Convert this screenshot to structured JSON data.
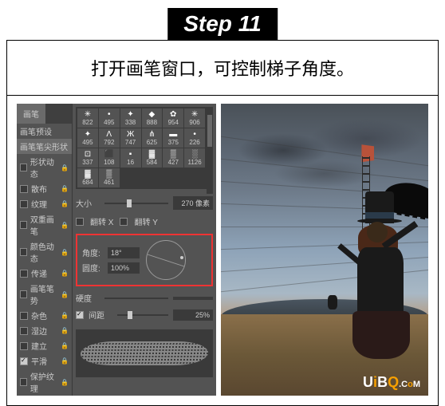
{
  "step": {
    "label": "Step 11"
  },
  "caption": "打开画笔窗口，可控制梯子角度。",
  "panel": {
    "tabs": {
      "brush": "画笔",
      "preset": "画笔预设"
    },
    "options": {
      "tipShape": "画笔笔尖形状",
      "shapeDyn": "形状动态",
      "scatter": "散布",
      "texture": "纹理",
      "dualBrush": "双重画笔",
      "colorDyn": "颜色动态",
      "transfer": "传递",
      "brushPose": "画笔笔势",
      "noise": "杂色",
      "wetEdge": "湿边",
      "buildUp": "建立",
      "smoothing": "平滑",
      "protect": "保护纹理"
    },
    "brushes": [
      {
        "n": "822"
      },
      {
        "n": "495"
      },
      {
        "n": "338"
      },
      {
        "n": "888"
      },
      {
        "n": "954"
      },
      {
        "n": "906"
      },
      {
        "n": "495"
      },
      {
        "n": "792"
      },
      {
        "n": "747"
      },
      {
        "n": "625"
      },
      {
        "n": "375"
      },
      {
        "n": "226"
      },
      {
        "n": "337"
      },
      {
        "n": "108"
      },
      {
        "n": "16"
      },
      {
        "n": "584"
      },
      {
        "n": "427"
      },
      {
        "n": "1126"
      },
      {
        "n": "684"
      },
      {
        "n": "461"
      }
    ],
    "size": {
      "label": "大小",
      "value": "270 像素"
    },
    "flip": {
      "x": "翻转 X",
      "y": "翻转 Y"
    },
    "angle": {
      "label": "角度:",
      "value": "18°"
    },
    "roundness": {
      "label": "圆度:",
      "value": "100%"
    },
    "hardness": {
      "label": "硬度"
    },
    "spacing": {
      "label": "间距",
      "value": "25%"
    }
  },
  "watermark": {
    "u": "U",
    "i": "i",
    "b": "B",
    "q": "Q",
    "dot": ".",
    "c": "C",
    "o": "o",
    "m": "M"
  }
}
